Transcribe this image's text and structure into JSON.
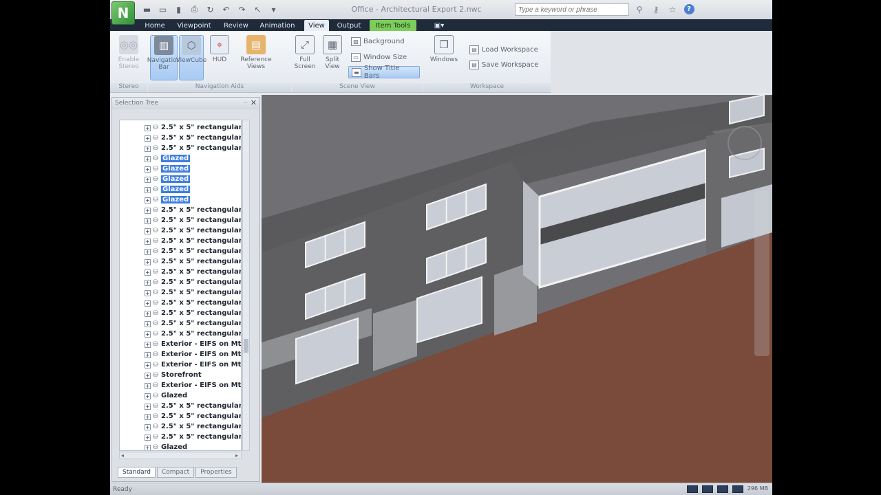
{
  "app": {
    "logo_letter": "N",
    "window_title": "Office - Architectural Export 2.nwc",
    "search_placeholder": "Type a keyword or phrase"
  },
  "quick_access": [
    "app-new-icon",
    "open-icon",
    "save-icon",
    "print-icon",
    "refresh-icon",
    "undo-icon",
    "redo-icon",
    "select-icon",
    "dropdown-icon"
  ],
  "title_tools": [
    "binoculars-icon",
    "key-icon",
    "star-icon",
    "help-icon"
  ],
  "tabs": [
    "Home",
    "Viewpoint",
    "Review",
    "Animation",
    "View",
    "Output",
    "Item Tools"
  ],
  "ribbon": {
    "stereo": {
      "button": "Enable Stereo",
      "group": "Stereo"
    },
    "navigation_aids": {
      "group": "Navigation Aids",
      "buttons": [
        "Navigation Bar",
        "ViewCube",
        "HUD",
        "Reference Views"
      ]
    },
    "scene_view": {
      "group": "Scene View",
      "buttons": [
        "Full Screen",
        "Split View"
      ],
      "small": [
        "Background",
        "Window Size",
        "Show Title Bars"
      ]
    },
    "workspace": {
      "group": "Workspace",
      "windows": "Windows",
      "small": [
        "Load Workspace",
        "Save Workspace"
      ]
    }
  },
  "selection_tree": {
    "title": "Selection Tree",
    "rows": [
      {
        "label": "2.5\" x 5\" rectangular",
        "selected": false
      },
      {
        "label": "2.5\" x 5\" rectangular",
        "selected": false
      },
      {
        "label": "2.5\" x 5\" rectangular",
        "selected": false
      },
      {
        "label": "Glazed",
        "selected": true
      },
      {
        "label": "Glazed",
        "selected": true
      },
      {
        "label": "Glazed",
        "selected": true
      },
      {
        "label": "Glazed",
        "selected": true
      },
      {
        "label": "Glazed",
        "selected": true
      },
      {
        "label": "2.5\" x 5\" rectangular",
        "selected": false
      },
      {
        "label": "2.5\" x 5\" rectangular",
        "selected": false
      },
      {
        "label": "2.5\" x 5\" rectangular",
        "selected": false
      },
      {
        "label": "2.5\" x 5\" rectangular",
        "selected": false
      },
      {
        "label": "2.5\" x 5\" rectangular",
        "selected": false
      },
      {
        "label": "2.5\" x 5\" rectangular",
        "selected": false
      },
      {
        "label": "2.5\" x 5\" rectangular",
        "selected": false
      },
      {
        "label": "2.5\" x 5\" rectangular",
        "selected": false
      },
      {
        "label": "2.5\" x 5\" rectangular",
        "selected": false
      },
      {
        "label": "2.5\" x 5\" rectangular",
        "selected": false
      },
      {
        "label": "2.5\" x 5\" rectangular",
        "selected": false
      },
      {
        "label": "2.5\" x 5\" rectangular",
        "selected": false
      },
      {
        "label": "2.5\" x 5\" rectangular",
        "selected": false
      },
      {
        "label": "Exterior - EIFS on Mtl.",
        "selected": false
      },
      {
        "label": "Exterior - EIFS on Mtl.",
        "selected": false
      },
      {
        "label": "Exterior - EIFS on Mtl.",
        "selected": false
      },
      {
        "label": "Storefront",
        "selected": false
      },
      {
        "label": "Exterior - EIFS on Mtl.",
        "selected": false
      },
      {
        "label": "Glazed",
        "selected": false
      },
      {
        "label": "2.5\" x 5\" rectangular",
        "selected": false
      },
      {
        "label": "2.5\" x 5\" rectangular",
        "selected": false
      },
      {
        "label": "2.5\" x 5\" rectangular",
        "selected": false
      },
      {
        "label": "2.5\" x 5\" rectangular",
        "selected": false
      },
      {
        "label": "Glazed",
        "selected": false
      }
    ],
    "tabs": [
      "Standard",
      "Compact",
      "Properties"
    ]
  },
  "status": {
    "text": "Ready",
    "zoom": "296 MB"
  },
  "colors": {
    "ground": "#7a4a3a",
    "wall": "#5f5f61",
    "roof": "#5a5a5c",
    "glass": "#c9ced6",
    "frame": "#f2f2f2",
    "selection": "#3d7ee0",
    "context_tab": "#7ccd5a"
  }
}
